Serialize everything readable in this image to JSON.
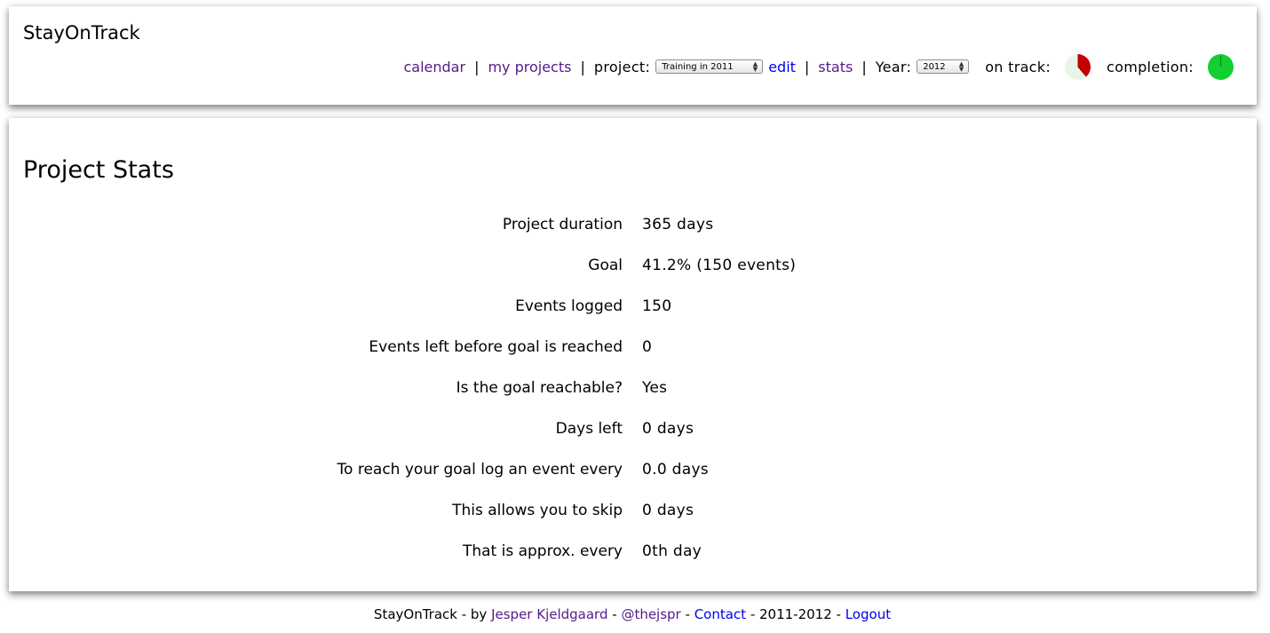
{
  "app": {
    "title": "StayOnTrack"
  },
  "nav": {
    "calendar": "calendar",
    "my_projects": "my projects",
    "project_label": "project:",
    "project_selected": "Training in 2011",
    "edit": "edit",
    "stats": "stats",
    "year_label": "Year:",
    "year_selected": "2012",
    "on_track_label": "on track:",
    "completion_label": "completion:",
    "separator": "|",
    "select_arrows_up": "▲",
    "select_arrows_down": "▼"
  },
  "indicators": {
    "on_track_fraction": 0.39,
    "on_track_color": "#c40000",
    "completion_fraction": 1.0,
    "completion_color": "#12cf32"
  },
  "main": {
    "title": "Project Stats",
    "stats": [
      {
        "label": "Project duration",
        "value": "365 days"
      },
      {
        "label": "Goal",
        "value": "41.2% (150 events)"
      },
      {
        "label": "Events logged",
        "value": "150"
      },
      {
        "label": "Events left before goal is reached",
        "value": "0"
      },
      {
        "label": "Is the goal reachable?",
        "value": "Yes"
      },
      {
        "label": "Days left",
        "value": "0 days"
      },
      {
        "label": "To reach your goal log an event every",
        "value": "0.0 days"
      },
      {
        "label": "This allows you to skip",
        "value": "0 days"
      },
      {
        "label": "That is approx. every",
        "value": "0th day"
      }
    ]
  },
  "footer": {
    "prefix": "StayOnTrack - by ",
    "author": "Jesper Kjeldgaard",
    "dash1": " - ",
    "twitter": "@thejspr",
    "dash2": " - ",
    "contact": "Contact",
    "years": " - 2011-2012 - ",
    "logout": "Logout"
  },
  "colors": {
    "visited_link": "#551a8b",
    "link": "#0000ee"
  }
}
